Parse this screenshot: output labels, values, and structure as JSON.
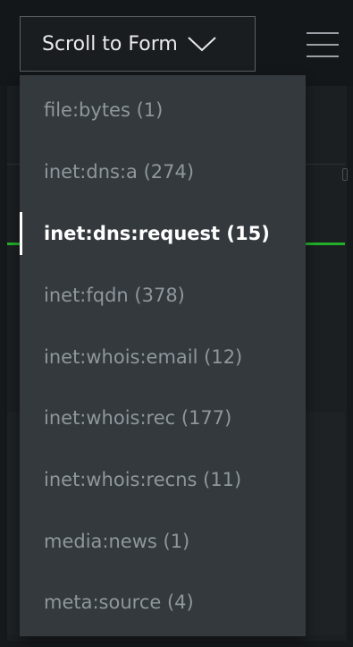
{
  "header": {
    "scroll_button_label": "Scroll to Form",
    "scroll_button_icon": "chevron-down-icon",
    "menu_icon": "hamburger-menu-icon"
  },
  "dropdown": {
    "items": [
      {
        "label": "file:bytes (1)",
        "active": false
      },
      {
        "label": "inet:dns:a (274)",
        "active": false
      },
      {
        "label": "inet:dns:request (15)",
        "active": true
      },
      {
        "label": "inet:fqdn (378)",
        "active": false
      },
      {
        "label": "inet:whois:email (12)",
        "active": false
      },
      {
        "label": "inet:whois:rec (177)",
        "active": false
      },
      {
        "label": "inet:whois:recns (11)",
        "active": false
      },
      {
        "label": "media:news (1)",
        "active": false
      },
      {
        "label": "meta:source (4)",
        "active": false
      }
    ]
  },
  "colors": {
    "accent_green": "#22b02a",
    "dropdown_bg": "#33393d",
    "active_text": "#ffffff",
    "inactive_text": "#8f979c"
  }
}
